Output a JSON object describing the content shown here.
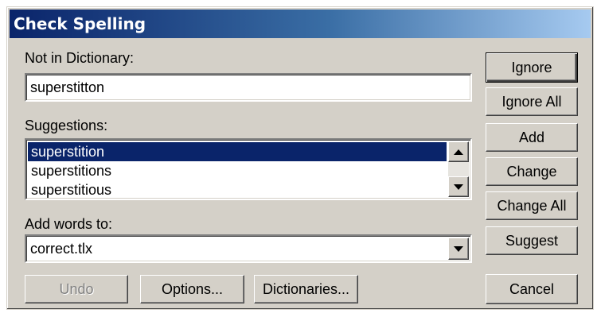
{
  "window": {
    "title": "Check Spelling"
  },
  "not_in_dictionary": {
    "label": "Not in Dictionary:",
    "value": "superstitton"
  },
  "suggestions": {
    "label": "Suggestions:",
    "items": [
      "superstition",
      "superstitions",
      "superstitious"
    ],
    "selected_index": 0
  },
  "add_words_to": {
    "label": "Add words to:",
    "value": "correct.tlx"
  },
  "buttons": {
    "ignore": "Ignore",
    "ignore_all": "Ignore All",
    "add": "Add",
    "change": "Change",
    "change_all": "Change All",
    "suggest": "Suggest",
    "cancel": "Cancel",
    "undo": "Undo",
    "options": "Options...",
    "dictionaries": "Dictionaries..."
  },
  "icons": {
    "scroll_up": "triangle-up",
    "scroll_down": "triangle-down",
    "combo_dropdown": "triangle-down"
  },
  "colors": {
    "dialog_face": "#d4d0c8",
    "title_start": "#0a246a",
    "title_end": "#a6caf0",
    "selection": "#0a246a"
  }
}
